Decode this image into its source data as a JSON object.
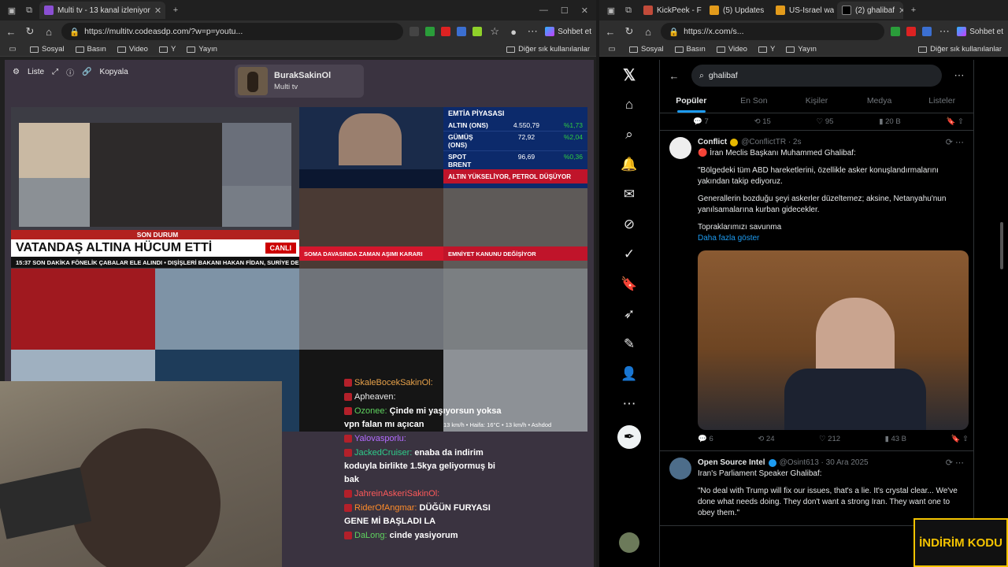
{
  "left_window": {
    "tab": {
      "title": "Multi tv - 13 kanal izleniyor"
    },
    "url": "https://multitv.codeasdp.com/?w=p=youtu...",
    "copilot": "Sohbet et",
    "bookmarks": [
      "Sosyal",
      "Basın",
      "Video",
      "Y",
      "Yayın"
    ],
    "bookmarks_other": "Diğer sık kullanılanlar"
  },
  "multitv": {
    "toolbar": {
      "list": "Liste",
      "copy": "Kopyala"
    },
    "channel": {
      "name": "BurakSakinOl",
      "sub": "Multi tv"
    },
    "tiles": {
      "cnn_banner_top": "SON DURUM",
      "cnn_banner_live": "CANLI",
      "cnn_headline": "VATANDAŞ ALTINA HÜCUM ETTİ",
      "cnn_ticker": "15:37  SON DAKİKA  FÖNELİK ÇABALAR ELE ALINDI  •  DIŞİŞLERİ BAKANI HAKAN FİDAN, SURİYE DE",
      "emtia_title": "EMTİA PİYASASI",
      "emtia_rows": [
        {
          "name": "ALTIN (ONS)",
          "value": "4.550,79",
          "change": "%1,73"
        },
        {
          "name": "GÜMÜŞ (ONS)",
          "value": "72,92",
          "change": "%2,04"
        },
        {
          "name": "SPOT BRENT",
          "value": "96,69",
          "change": "%0,36"
        }
      ],
      "emtia_ticker": "ALTIN YÜKSELİYOR, PETROL DÜŞÜYOR",
      "soma_ticker": "SOMA DAVASINDA ZAMAN AŞIMI KARARI",
      "emniyet_ticker": "EMNİYET KANUNU DEĞİŞİYOR",
      "weather_caption": "13 km/h  •  Haifa: 16°C  •  13 km/h  •  Ashdod"
    }
  },
  "chat": {
    "messages": [
      {
        "user": "SkaleBocekSakinOl:",
        "text": "",
        "color": "#e8a24a"
      },
      {
        "user": "Apheaven:",
        "text": "",
        "color": "#e8e8e8"
      },
      {
        "user": "Ozonee:",
        "text": "Çinde mi yaşıyorsun yoksa vpn falan mı açıcan",
        "color": "#5fd35f"
      },
      {
        "user": "Yalovasporlu:",
        "text": "",
        "color": "#b36bff"
      },
      {
        "user": "JackedCruiser:",
        "text": "enaba da indirim koduyla birlikte 1.5kya geliyormuş bi bak",
        "color": "#2ecc8a"
      },
      {
        "user": "JahreinAskeriSakinOl:",
        "text": "",
        "color": "#ff5a5a"
      },
      {
        "user": "RiderOfAngmar:",
        "text": "DÜĞÜN FURYASI GENE Mİ BAŞLADI LA",
        "color": "#ff8c2a"
      },
      {
        "user": "DaLong:",
        "text": "cinde yasiyorum",
        "color": "#5fd35f"
      }
    ]
  },
  "right_window": {
    "tabs": [
      "KickPeek - F",
      "(5) Updates",
      "US-Israel wa",
      "(2) ghalibaf"
    ],
    "url": "https://x.com/s...",
    "copilot": "Sohbet et",
    "bookmarks": [
      "Sosyal",
      "Basın",
      "Video",
      "Y",
      "Yayın"
    ],
    "bookmarks_other": "Diğer sık kullanılanlar"
  },
  "x": {
    "search_value": "ghalibaf",
    "tabs": [
      "Popüler",
      "En Son",
      "Kişiler",
      "Medya",
      "Listeler"
    ],
    "prev_metrics": {
      "replies": "7",
      "reposts": "15",
      "likes": "95",
      "views": "20 B"
    },
    "tweet1": {
      "name": "Conflict",
      "handle": "@ConflictTR · 2s",
      "line1": "🔴 İran Meclis Başkanı Muhammed Ghalibaf:",
      "p1": "\"Bölgedeki tüm ABD hareketlerini, özellikle asker konuşlandırmalarını yakından takip ediyoruz.",
      "p2": "Generallerin bozduğu şeyi askerler düzeltemez; aksine, Netanyahu'nun yanılsamalarına kurban gidecekler.",
      "p3": "Topraklarımızı savunma",
      "more": "Daha fazla göster",
      "metrics": {
        "replies": "6",
        "reposts": "24",
        "likes": "212",
        "views": "43 B"
      }
    },
    "tweet2": {
      "name": "Open Source Intel",
      "handle": "@Osint613 · 30 Ara 2025",
      "line1": "Iran's Parliament Speaker Ghalibaf:",
      "p1": "\"No deal with Trump will fix our issues, that's a lie. It's crystal clear... We've done what needs doing. They don't want a strong Iran. They want one to obey them.\""
    }
  },
  "overlay": {
    "promo": "İNDİRİM KODU"
  },
  "colors": {
    "x_blue": "#1d9bf0",
    "cnn_red": "#cc0000",
    "emtia_blue": "#0c2a6b"
  }
}
